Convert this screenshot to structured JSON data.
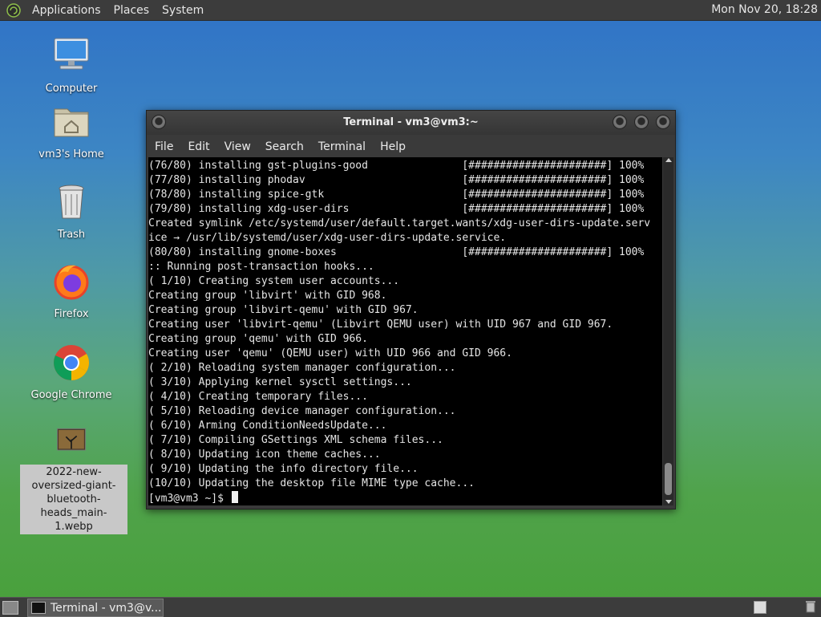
{
  "top_panel": {
    "menus": [
      "Applications",
      "Places",
      "System"
    ],
    "clock": "Mon Nov 20, 18:28"
  },
  "desktop": {
    "icons": [
      {
        "label": "Computer",
        "icon": "computer-icon"
      },
      {
        "label": "vm3's Home",
        "icon": "home-folder-icon"
      },
      {
        "label": "Trash",
        "icon": "trash-icon"
      },
      {
        "label": "Firefox",
        "icon": "firefox-icon"
      },
      {
        "label": "Google Chrome",
        "icon": "chrome-icon"
      },
      {
        "label": "2022-new-oversized-giant-bluetooth-heads_main-1.webp",
        "icon": "image-file-icon"
      }
    ]
  },
  "terminal": {
    "title": "Terminal - vm3@vm3:~",
    "menu": [
      "File",
      "Edit",
      "View",
      "Search",
      "Terminal",
      "Help"
    ],
    "lines": [
      "(76/80) installing gst-plugins-good               [######################] 100%",
      "(77/80) installing phodav                         [######################] 100%",
      "(78/80) installing spice-gtk                      [######################] 100%",
      "(79/80) installing xdg-user-dirs                  [######################] 100%",
      "Created symlink /etc/systemd/user/default.target.wants/xdg-user-dirs-update.serv",
      "ice → /usr/lib/systemd/user/xdg-user-dirs-update.service.",
      "(80/80) installing gnome-boxes                    [######################] 100%",
      ":: Running post-transaction hooks...",
      "( 1/10) Creating system user accounts...",
      "Creating group 'libvirt' with GID 968.",
      "Creating group 'libvirt-qemu' with GID 967.",
      "Creating user 'libvirt-qemu' (Libvirt QEMU user) with UID 967 and GID 967.",
      "Creating group 'qemu' with GID 966.",
      "Creating user 'qemu' (QEMU user) with UID 966 and GID 966.",
      "( 2/10) Reloading system manager configuration...",
      "( 3/10) Applying kernel sysctl settings...",
      "( 4/10) Creating temporary files...",
      "( 5/10) Reloading device manager configuration...",
      "( 6/10) Arming ConditionNeedsUpdate...",
      "( 7/10) Compiling GSettings XML schema files...",
      "( 8/10) Updating icon theme caches...",
      "( 9/10) Updating the info directory file...",
      "(10/10) Updating the desktop file MIME type cache..."
    ],
    "prompt": "[vm3@vm3 ~]$ "
  },
  "bottom_panel": {
    "task_label": "Terminal - vm3@v..."
  }
}
